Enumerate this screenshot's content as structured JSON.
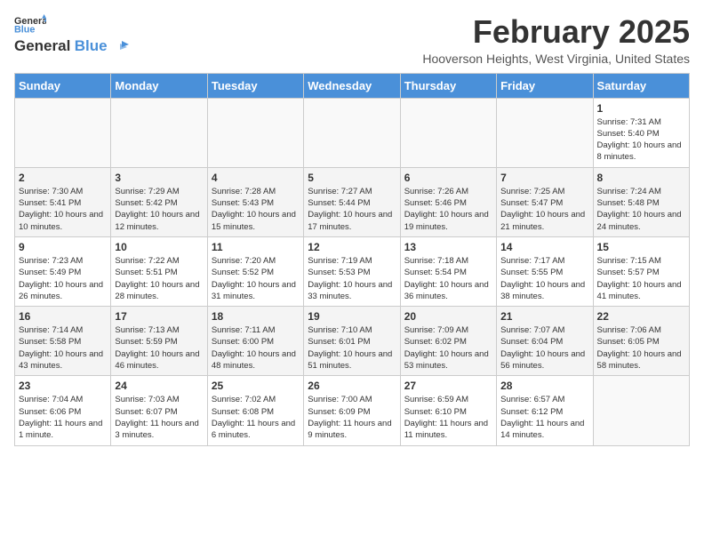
{
  "header": {
    "logo_line1": "General",
    "logo_line2": "Blue",
    "month_title": "February 2025",
    "location": "Hooverson Heights, West Virginia, United States"
  },
  "days_of_week": [
    "Sunday",
    "Monday",
    "Tuesday",
    "Wednesday",
    "Thursday",
    "Friday",
    "Saturday"
  ],
  "weeks": [
    [
      {
        "day": "",
        "info": ""
      },
      {
        "day": "",
        "info": ""
      },
      {
        "day": "",
        "info": ""
      },
      {
        "day": "",
        "info": ""
      },
      {
        "day": "",
        "info": ""
      },
      {
        "day": "",
        "info": ""
      },
      {
        "day": "1",
        "info": "Sunrise: 7:31 AM\nSunset: 5:40 PM\nDaylight: 10 hours and 8 minutes."
      }
    ],
    [
      {
        "day": "2",
        "info": "Sunrise: 7:30 AM\nSunset: 5:41 PM\nDaylight: 10 hours and 10 minutes."
      },
      {
        "day": "3",
        "info": "Sunrise: 7:29 AM\nSunset: 5:42 PM\nDaylight: 10 hours and 12 minutes."
      },
      {
        "day": "4",
        "info": "Sunrise: 7:28 AM\nSunset: 5:43 PM\nDaylight: 10 hours and 15 minutes."
      },
      {
        "day": "5",
        "info": "Sunrise: 7:27 AM\nSunset: 5:44 PM\nDaylight: 10 hours and 17 minutes."
      },
      {
        "day": "6",
        "info": "Sunrise: 7:26 AM\nSunset: 5:46 PM\nDaylight: 10 hours and 19 minutes."
      },
      {
        "day": "7",
        "info": "Sunrise: 7:25 AM\nSunset: 5:47 PM\nDaylight: 10 hours and 21 minutes."
      },
      {
        "day": "8",
        "info": "Sunrise: 7:24 AM\nSunset: 5:48 PM\nDaylight: 10 hours and 24 minutes."
      }
    ],
    [
      {
        "day": "9",
        "info": "Sunrise: 7:23 AM\nSunset: 5:49 PM\nDaylight: 10 hours and 26 minutes."
      },
      {
        "day": "10",
        "info": "Sunrise: 7:22 AM\nSunset: 5:51 PM\nDaylight: 10 hours and 28 minutes."
      },
      {
        "day": "11",
        "info": "Sunrise: 7:20 AM\nSunset: 5:52 PM\nDaylight: 10 hours and 31 minutes."
      },
      {
        "day": "12",
        "info": "Sunrise: 7:19 AM\nSunset: 5:53 PM\nDaylight: 10 hours and 33 minutes."
      },
      {
        "day": "13",
        "info": "Sunrise: 7:18 AM\nSunset: 5:54 PM\nDaylight: 10 hours and 36 minutes."
      },
      {
        "day": "14",
        "info": "Sunrise: 7:17 AM\nSunset: 5:55 PM\nDaylight: 10 hours and 38 minutes."
      },
      {
        "day": "15",
        "info": "Sunrise: 7:15 AM\nSunset: 5:57 PM\nDaylight: 10 hours and 41 minutes."
      }
    ],
    [
      {
        "day": "16",
        "info": "Sunrise: 7:14 AM\nSunset: 5:58 PM\nDaylight: 10 hours and 43 minutes."
      },
      {
        "day": "17",
        "info": "Sunrise: 7:13 AM\nSunset: 5:59 PM\nDaylight: 10 hours and 46 minutes."
      },
      {
        "day": "18",
        "info": "Sunrise: 7:11 AM\nSunset: 6:00 PM\nDaylight: 10 hours and 48 minutes."
      },
      {
        "day": "19",
        "info": "Sunrise: 7:10 AM\nSunset: 6:01 PM\nDaylight: 10 hours and 51 minutes."
      },
      {
        "day": "20",
        "info": "Sunrise: 7:09 AM\nSunset: 6:02 PM\nDaylight: 10 hours and 53 minutes."
      },
      {
        "day": "21",
        "info": "Sunrise: 7:07 AM\nSunset: 6:04 PM\nDaylight: 10 hours and 56 minutes."
      },
      {
        "day": "22",
        "info": "Sunrise: 7:06 AM\nSunset: 6:05 PM\nDaylight: 10 hours and 58 minutes."
      }
    ],
    [
      {
        "day": "23",
        "info": "Sunrise: 7:04 AM\nSunset: 6:06 PM\nDaylight: 11 hours and 1 minute."
      },
      {
        "day": "24",
        "info": "Sunrise: 7:03 AM\nSunset: 6:07 PM\nDaylight: 11 hours and 3 minutes."
      },
      {
        "day": "25",
        "info": "Sunrise: 7:02 AM\nSunset: 6:08 PM\nDaylight: 11 hours and 6 minutes."
      },
      {
        "day": "26",
        "info": "Sunrise: 7:00 AM\nSunset: 6:09 PM\nDaylight: 11 hours and 9 minutes."
      },
      {
        "day": "27",
        "info": "Sunrise: 6:59 AM\nSunset: 6:10 PM\nDaylight: 11 hours and 11 minutes."
      },
      {
        "day": "28",
        "info": "Sunrise: 6:57 AM\nSunset: 6:12 PM\nDaylight: 11 hours and 14 minutes."
      },
      {
        "day": "",
        "info": ""
      }
    ]
  ]
}
